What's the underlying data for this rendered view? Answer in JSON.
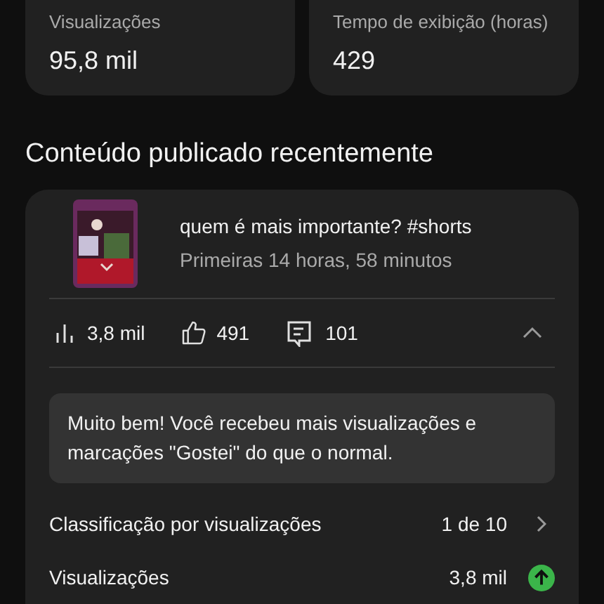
{
  "metrics": [
    {
      "label": "Visualizações",
      "value": "95,8 mil"
    },
    {
      "label": "Tempo de exibição (horas)",
      "value": "429"
    }
  ],
  "section_title": "Conteúdo publicado recentemente",
  "video": {
    "title": "quem é mais importante? #shorts",
    "subtitle": "Primeiras 14 horas, 58 minutos",
    "views": "3,8 mil",
    "likes": "491",
    "comments": "101",
    "expanded": true
  },
  "message": "Muito bem! Você recebeu mais visualizações e marcações \"Gostei\" do que o normal.",
  "rows": [
    {
      "kind": "link",
      "label": "Classificação por visualizações",
      "value": "1 de 10"
    },
    {
      "kind": "trend",
      "label": "Visualizações",
      "value": "3,8 mil",
      "rising": true
    }
  ]
}
